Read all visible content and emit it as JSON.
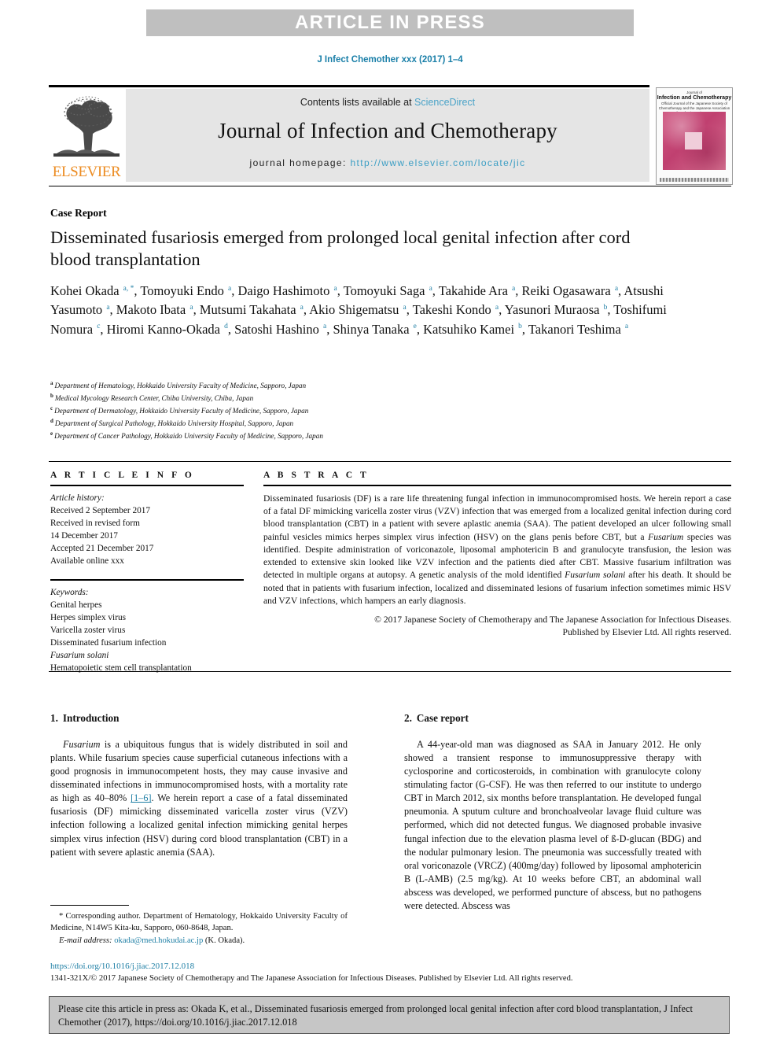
{
  "banner": {
    "label": "ARTICLE IN PRESS"
  },
  "running_head": "J Infect Chemother xxx (2017) 1–4",
  "masthead": {
    "contents_prefix": "Contents lists available at ",
    "contents_link": "ScienceDirect",
    "journal_name": "Journal of Infection and Chemotherapy",
    "homepage_prefix": "journal homepage: ",
    "homepage_url": "http://www.elsevier.com/locate/jic",
    "publisher_logo": "ELSEVIER",
    "cover": {
      "kicker": "Journal of",
      "title": "Infection and Chemotherapy",
      "subtitle": "Official Journal of the Japanese Society of Chemotherapy and the Japanese Association for Infectious Diseases"
    }
  },
  "article": {
    "doctype": "Case Report",
    "title": "Disseminated fusariosis emerged from prolonged local genital infection after cord blood transplantation",
    "authors": "Kohei Okada a, *, Tomoyuki Endo a, Daigo Hashimoto a, Tomoyuki Saga a, Takahide Ara a, Reiki Ogasawara a, Atsushi Yasumoto a, Makoto Ibata a, Mutsumi Takahata a, Akio Shigematsu a, Takeshi Kondo a, Yasunori Muraosa b, Toshifumi Nomura c, Hiromi Kanno-Okada d, Satoshi Hashino a, Shinya Tanaka e, Katsuhiko Kamei b, Takanori Teshima a",
    "author_list": [
      {
        "name": "Kohei Okada",
        "marks": "a, *"
      },
      {
        "name": "Tomoyuki Endo",
        "marks": "a"
      },
      {
        "name": "Daigo Hashimoto",
        "marks": "a"
      },
      {
        "name": "Tomoyuki Saga",
        "marks": "a"
      },
      {
        "name": "Takahide Ara",
        "marks": "a"
      },
      {
        "name": "Reiki Ogasawara",
        "marks": "a"
      },
      {
        "name": "Atsushi Yasumoto",
        "marks": "a"
      },
      {
        "name": "Makoto Ibata",
        "marks": "a"
      },
      {
        "name": "Mutsumi Takahata",
        "marks": "a"
      },
      {
        "name": "Akio Shigematsu",
        "marks": "a"
      },
      {
        "name": "Takeshi Kondo",
        "marks": "a"
      },
      {
        "name": "Yasunori Muraosa",
        "marks": "b"
      },
      {
        "name": "Toshifumi Nomura",
        "marks": "c"
      },
      {
        "name": "Hiromi Kanno-Okada",
        "marks": "d"
      },
      {
        "name": "Satoshi Hashino",
        "marks": "a"
      },
      {
        "name": "Shinya Tanaka",
        "marks": "e"
      },
      {
        "name": "Katsuhiko Kamei",
        "marks": "b"
      },
      {
        "name": "Takanori Teshima",
        "marks": "a"
      }
    ],
    "affiliations": [
      {
        "mark": "a",
        "text": "Department of Hematology, Hokkaido University Faculty of Medicine, Sapporo, Japan"
      },
      {
        "mark": "b",
        "text": "Medical Mycology Research Center, Chiba University, Chiba, Japan"
      },
      {
        "mark": "c",
        "text": "Department of Dermatology, Hokkaido University Faculty of Medicine, Sapporo, Japan"
      },
      {
        "mark": "d",
        "text": "Department of Surgical Pathology, Hokkaido University Hospital, Sapporo, Japan"
      },
      {
        "mark": "e",
        "text": "Department of Cancer Pathology, Hokkaido University Faculty of Medicine, Sapporo, Japan"
      }
    ]
  },
  "article_info": {
    "heading": "ARTICLE INFO",
    "history_label": "Article history:",
    "history": [
      "Received 2 September 2017",
      "Received in revised form",
      "14 December 2017",
      "Accepted 21 December 2017",
      "Available online xxx"
    ],
    "keywords_label": "Keywords:",
    "keywords": [
      "Genital herpes",
      "Herpes simplex virus",
      "Varicella zoster virus",
      "Disseminated fusarium infection",
      "Fusarium solani",
      "Hematopoietic stem cell transplantation"
    ],
    "keywords_italic_index": 4
  },
  "abstract": {
    "heading": "ABSTRACT",
    "text": "Disseminated fusariosis (DF) is a rare life threatening fungal infection in immunocompromised hosts. We herein report a case of a fatal DF mimicking varicella zoster virus (VZV) infection that was emerged from a localized genital infection during cord blood transplantation (CBT) in a patient with severe aplastic anemia (SAA). The patient developed an ulcer following small painful vesicles mimics herpes simplex virus infection (HSV) on the glans penis before CBT, but a Fusarium species was identified. Despite administration of voriconazole, liposomal amphotericin B and granulocyte transfusion, the lesion was extended to extensive skin looked like VZV infection and the patients died after CBT. Massive fusarium infiltration was detected in multiple organs at autopsy. A genetic analysis of the mold identified Fusarium solani after his death. It should be noted that in patients with fusarium infection, localized and disseminated lesions of fusarium infection sometimes mimic HSV and VZV infections, which hampers an early diagnosis.",
    "copyright_line1": "© 2017 Japanese Society of Chemotherapy and The Japanese Association for Infectious Diseases.",
    "copyright_line2": "Published by Elsevier Ltd. All rights reserved."
  },
  "sections": {
    "intro": {
      "number": "1.",
      "title": "Introduction",
      "paragraph_pre": "Fusarium",
      "paragraph_a": " is a ubiquitous fungus that is widely distributed in soil and plants. While fusarium species cause superficial cutaneous infections with a good prognosis in immunocompetent hosts, they may cause invasive and disseminated infections in immunocompromised hosts, with a mortality rate as high as 40–80% ",
      "citation": "[1–6]",
      "paragraph_b": ". We herein report a case of a fatal disseminated fusariosis (DF) mimicking disseminated varicella zoster virus (VZV) infection following a localized genital infection mimicking genital herpes simplex virus infection (HSV) during cord blood transplantation (CBT) in a patient with severe aplastic anemia (SAA)."
    },
    "case": {
      "number": "2.",
      "title": "Case report",
      "paragraph": "A 44-year-old man was diagnosed as SAA in January 2012. He only showed a transient response to immunosuppressive therapy with cyclosporine and corticosteroids, in combination with granulocyte colony stimulating factor (G-CSF). He was then referred to our institute to undergo CBT in March 2012, six months before transplantation. He developed fungal pneumonia. A sputum culture and bronchoalveolar lavage fluid culture was performed, which did not detected fungus. We diagnosed probable invasive fungal infection due to the elevation plasma level of ß-D-glucan (BDG) and the nodular pulmonary lesion. The pneumonia was successfully treated with oral voriconazole (VRCZ) (400mg/day) followed by liposomal amphotericin B (L-AMB) (2.5 mg/kg). At 10 weeks before CBT, an abdominal wall abscess was developed, we performed puncture of abscess, but no pathogens were detected. Abscess was"
    }
  },
  "footnote": {
    "text": "* Corresponding author. Department of Hematology, Hokkaido University Faculty of Medicine, N14W5 Kita-ku, Sapporo, 060-8648, Japan.",
    "email_label": "E-mail address:",
    "email": "okada@med.hokudai.ac.jp",
    "email_owner": "(K. Okada)."
  },
  "footer": {
    "doi": "https://doi.org/10.1016/j.jiac.2017.12.018",
    "issn_line": "1341-321X/© 2017 Japanese Society of Chemotherapy and The Japanese Association for Infectious Diseases. Published by Elsevier Ltd. All rights reserved."
  },
  "cite_box": {
    "text": "Please cite this article in press as: Okada K, et al., Disseminated fusariosis emerged from prolonged local genital infection after cord blood transplantation, J Infect Chemother (2017), https://doi.org/10.1016/j.jiac.2017.12.018"
  },
  "colors": {
    "link": "#1f7fa5",
    "banner_bg": "#bfbfbf",
    "masthead_bg": "#e5e5e5",
    "cite_bg": "#c6c6c6",
    "elsevier_orange": "#ec8c22"
  }
}
